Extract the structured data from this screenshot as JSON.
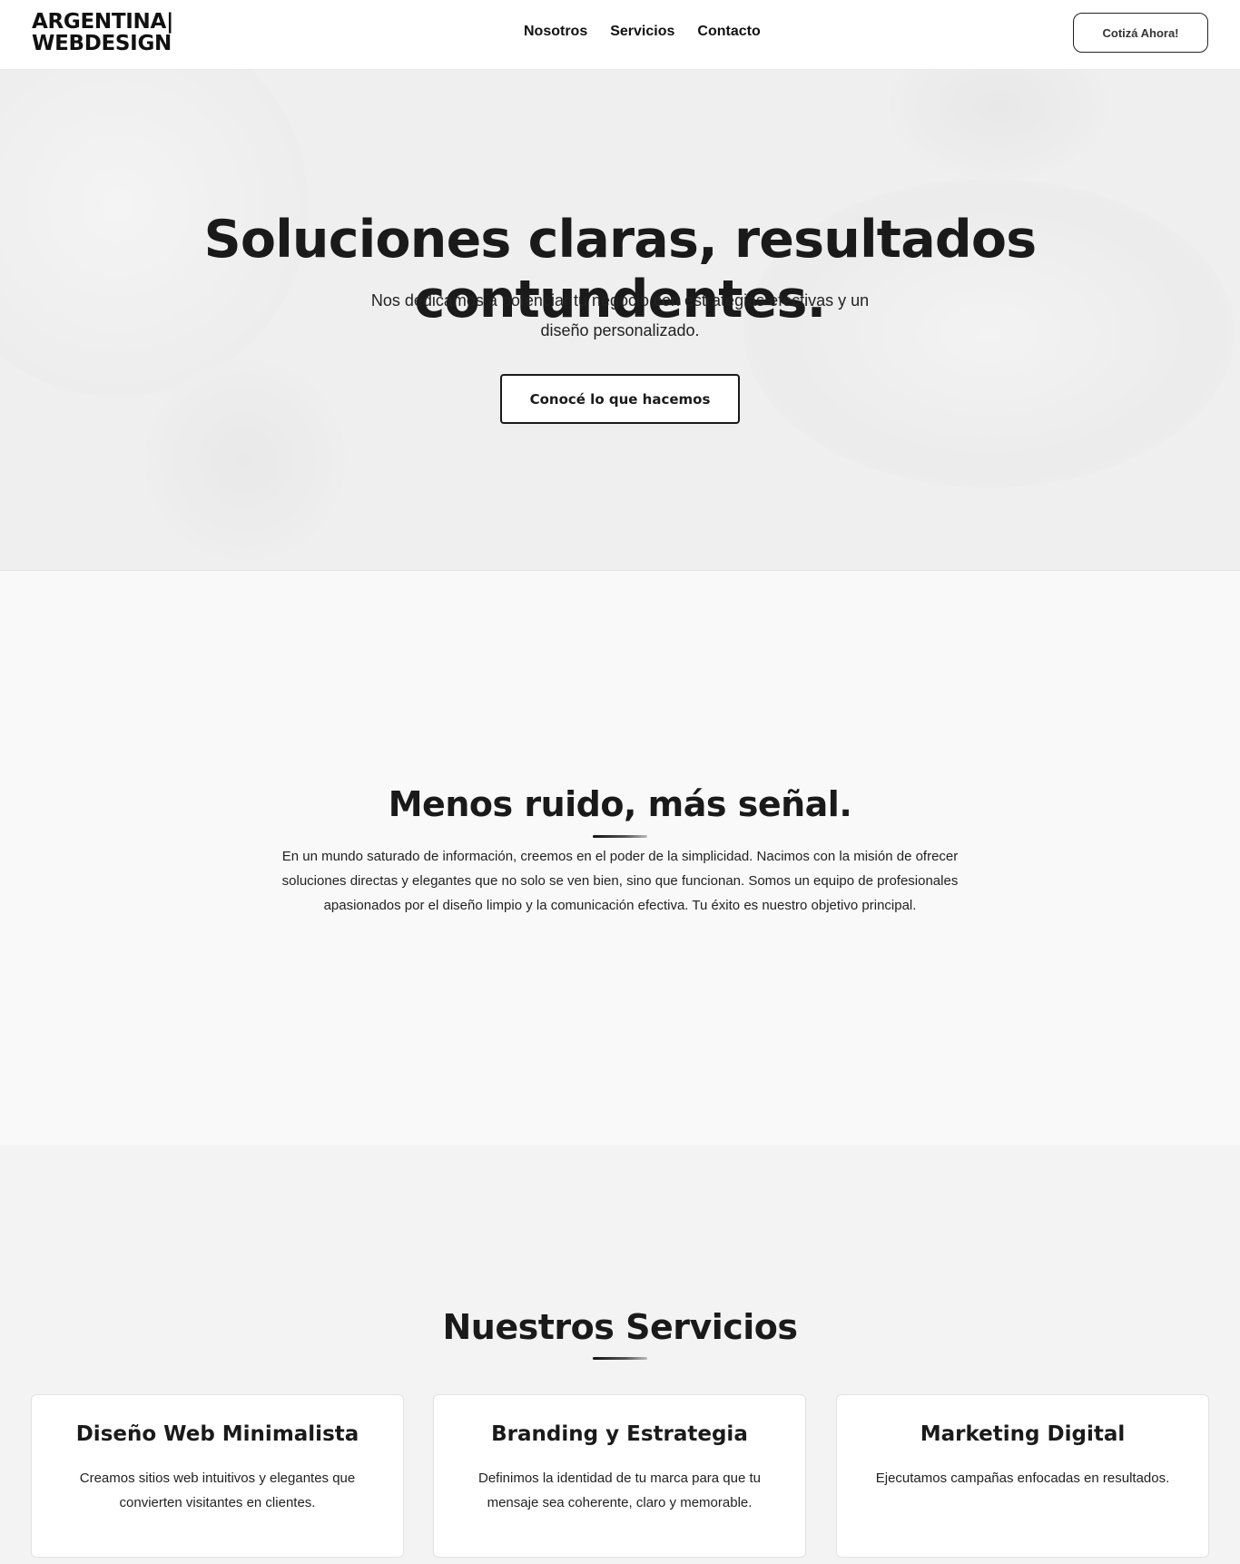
{
  "header": {
    "logo_line1": "ARGENTINA|",
    "logo_line2": "WEBDESIGN",
    "nav": [
      "Nosotros",
      "Servicios",
      "Contacto"
    ],
    "cta_label": "Cotizá Ahora!"
  },
  "hero": {
    "title": "Soluciones claras, resultados contundentes.",
    "subtitle": "Nos dedicamos a potenciar tu negocio con estrategias efectivas y un diseño personalizado.",
    "cta_label": "Conocé lo que hacemos"
  },
  "about": {
    "title": "Menos ruido, más señal.",
    "text": "En un mundo saturado de información, creemos en el poder de la simplicidad. Nacimos con la misión de ofrecer soluciones directas y elegantes que no solo se ven bien, sino que funcionan. Somos un equipo de profesionales apasionados por el diseño limpio y la comunicación efectiva. Tu éxito es nuestro objetivo principal."
  },
  "services": {
    "title": "Nuestros Servicios",
    "cards": [
      {
        "title": "Diseño Web Minimalista",
        "text": "Creamos sitios web intuitivos y elegantes que convierten visitantes en clientes."
      },
      {
        "title": "Branding y Estrategia",
        "text": "Definimos la identidad de tu marca para que tu mensaje sea coherente, claro y memorable."
      },
      {
        "title": "Marketing Digital",
        "text": "Ejecutamos campañas enfocadas en resultados."
      }
    ]
  },
  "colors": {
    "text": "#1a1a1a",
    "hero_bg": "#efefef",
    "about_bg": "#f9f9f9",
    "services_bg": "#f3f3f3",
    "card_bg": "#ffffff"
  }
}
